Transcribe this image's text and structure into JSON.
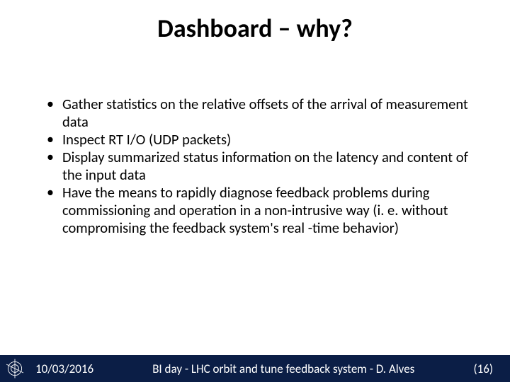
{
  "title": "Dashboard – why?",
  "bullets": [
    "Gather statistics on the relative offsets of the arrival of measurement data",
    "Inspect RT I/O (UDP packets)",
    "Display summarized status information on the latency and content of the input data",
    "Have the means to rapidly diagnose feedback problems during commissioning and operation in a non-intrusive way (i. e. without compromising the feedback system's real -time behavior)"
  ],
  "footer": {
    "date": "10/03/2016",
    "center": "BI day - LHC orbit and tune feedback system - D. Alves",
    "page": "(16)",
    "logo_name": "cern-logo"
  }
}
